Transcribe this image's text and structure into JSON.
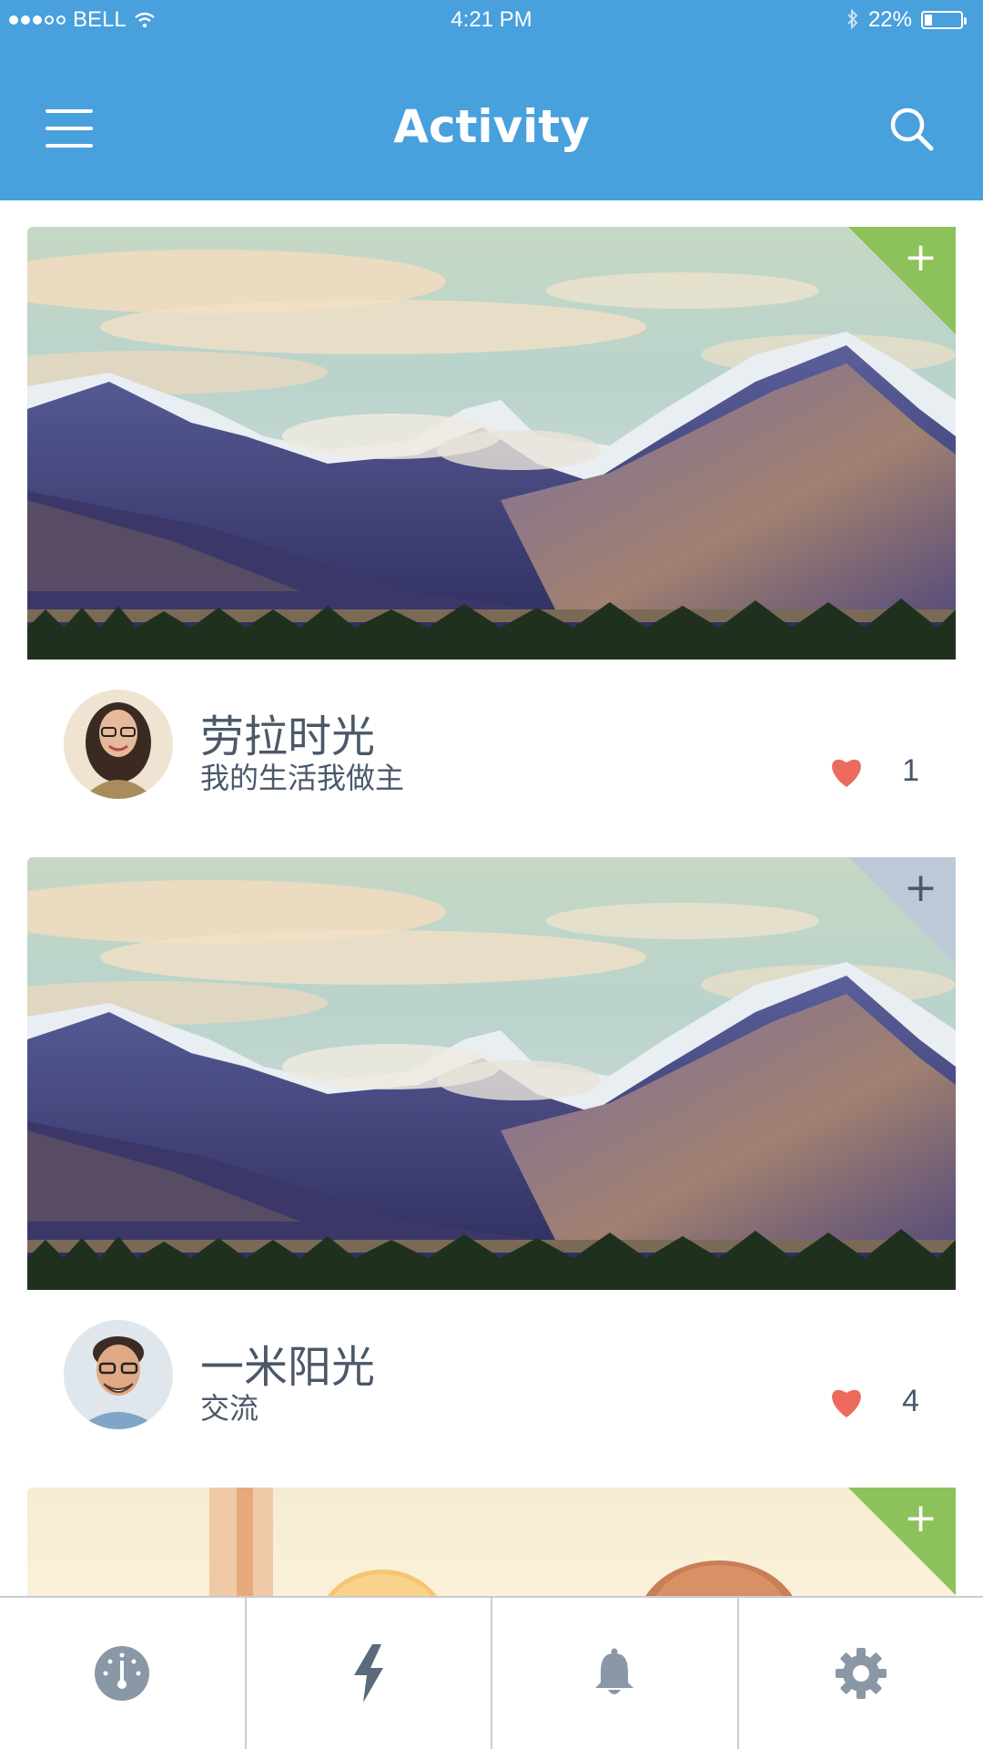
{
  "status_bar": {
    "carrier": "BELL",
    "time": "4:21 PM",
    "battery": "22%",
    "signal_bars_filled": 3,
    "signal_bars_total": 5,
    "battery_level": 0.22
  },
  "header": {
    "title": "Activity",
    "menu_icon": "hamburger-menu-icon",
    "search_icon": "search-icon",
    "background": "#48a0dc"
  },
  "cards": [
    {
      "image": "mountain-landscape",
      "corner_color": "#8dc15a",
      "corner_icon": "+",
      "name": "劳拉时光",
      "subtitle": "我的生活我做主",
      "likes": "1"
    },
    {
      "image": "mountain-landscape",
      "corner_color": "#bccad8",
      "corner_icon": "+",
      "name": "一米阳光",
      "subtitle": "交流",
      "likes": "4"
    },
    {
      "image": "portrait-photo",
      "corner_color": "#8dc15a",
      "corner_icon": "+"
    }
  ],
  "like_color": "#ec6b5e",
  "tabbar": {
    "tabs": [
      {
        "icon": "gauge-icon"
      },
      {
        "icon": "lightning-icon"
      },
      {
        "icon": "bell-icon"
      },
      {
        "icon": "gear-icon"
      }
    ],
    "icon_color": "#8a97a6"
  }
}
